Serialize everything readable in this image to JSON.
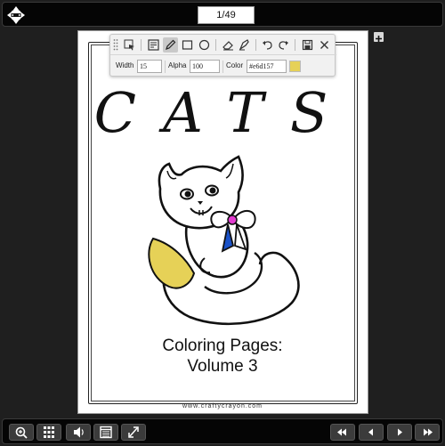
{
  "topbar": {
    "page_indicator": "1/49",
    "move_icon": "move-arrows-icon"
  },
  "annotation_toolbar": {
    "tools": [
      "select-icon",
      "sticky-note-icon",
      "pencil-icon",
      "rectangle-icon",
      "circle-icon",
      "eraser-icon",
      "highlighter-icon",
      "undo-icon",
      "redo-icon",
      "save-icon",
      "close-icon"
    ],
    "active_tool": "pencil-icon",
    "width_label": "Width",
    "width_value": "15",
    "alpha_label": "Alpha",
    "alpha_value": "100",
    "color_label": "Color",
    "color_value": "#e6d157",
    "swatch_color": "#e6d157"
  },
  "page": {
    "title": "CATS",
    "subtitle_line1": "Coloring Pages:",
    "subtitle_line2": "Volume 3",
    "url": "www.craftycrayon.com"
  },
  "bottombar": {
    "left_buttons": [
      "zoom-in-icon",
      "thumbnails-grid-icon",
      "sound-icon",
      "book-icon",
      "fullscreen-icon"
    ],
    "right_buttons": [
      "first-page-icon",
      "previous-page-icon",
      "next-page-icon",
      "last-page-icon"
    ]
  },
  "colors": {
    "background": "#1f1f1f",
    "bar": "#050505",
    "button": "#3b3b3b",
    "fill_yellow": "#e6d157",
    "ribbon_blue": "#1a52c8",
    "ribbon_pink": "#e23bd0"
  }
}
